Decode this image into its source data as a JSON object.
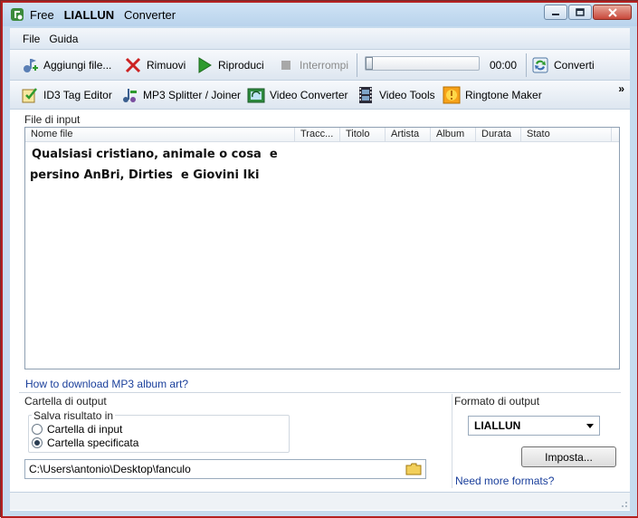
{
  "window": {
    "title_prefix": "Free",
    "title_name": "LIALLUN",
    "title_suffix": "Converter"
  },
  "menu": {
    "file": "File",
    "guida": "Guida"
  },
  "toolbar": {
    "add_files": "Aggiungi file...",
    "remove": "Rimuovi",
    "play": "Riproduci",
    "stop": "Interrompi",
    "time": "00:00",
    "convert": "Converti"
  },
  "tools": {
    "id3": "ID3 Tag Editor",
    "mp3splitter": "MP3 Splitter / Joiner",
    "videoconv": "Video Converter",
    "videotools": "Video Tools",
    "ringtone": "Ringtone Maker",
    "more": "»"
  },
  "input": {
    "section_label": "File di input",
    "columns": [
      "Nome file",
      "Tracc...",
      "Titolo",
      "Artista",
      "Album",
      "Durata",
      "Stato"
    ],
    "overlay_line1": "Qualsiasi cristiano, animale o cosa  e",
    "overlay_line2": "persino AnBri, Dirties  e Giovini Iki"
  },
  "links": {
    "album_art": "How to download MP3 album art?",
    "more_formats": "Need more formats?"
  },
  "output": {
    "folder_label": "Cartella di output",
    "save_group": "Salva risultato in",
    "radio_input": "Cartella di input",
    "radio_specified": "Cartella specificata",
    "selected": "specified",
    "path": "C:\\Users\\antonio\\Desktop\\fanculo",
    "format_label": "Formato di output",
    "format_value": "LIALLUN",
    "settings_button": "Imposta..."
  }
}
